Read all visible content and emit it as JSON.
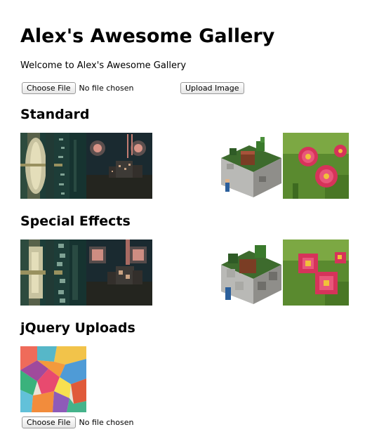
{
  "page": {
    "title": "Alex's Awesome Gallery",
    "welcome": "Welcome to Alex's Awesome Gallery"
  },
  "upload_form": {
    "choose_file_label": "Choose File",
    "no_file_text": "No file chosen",
    "upload_button_label": "Upload Image"
  },
  "sections": [
    {
      "title": "Standard",
      "images": [
        {
          "name": "lake-image",
          "icon": "landscape-photo"
        },
        {
          "name": "night-scene-image",
          "icon": "night-photo"
        },
        {
          "name": "lego-minecraft-image",
          "icon": "lego-model-photo"
        },
        {
          "name": "pink-flowers-image",
          "icon": "flower-photo"
        }
      ]
    },
    {
      "title": "Special Effects",
      "images": [
        {
          "name": "lake-image-effect",
          "icon": "landscape-photo"
        },
        {
          "name": "night-scene-image-effect",
          "icon": "night-photo"
        },
        {
          "name": "lego-minecraft-image-effect",
          "icon": "lego-model-photo"
        },
        {
          "name": "pink-flowers-image-effect",
          "icon": "flower-photo"
        }
      ]
    },
    {
      "title": "jQuery Uploads",
      "images": [
        {
          "name": "colorful-cubes-image",
          "icon": "geometric-cubes-art"
        }
      ]
    }
  ],
  "jquery_upload": {
    "choose_file_label": "Choose File",
    "no_file_text": "No file chosen"
  },
  "colors": {
    "text": "#000000",
    "background": "#ffffff",
    "button_border": "#9a9a9a"
  }
}
